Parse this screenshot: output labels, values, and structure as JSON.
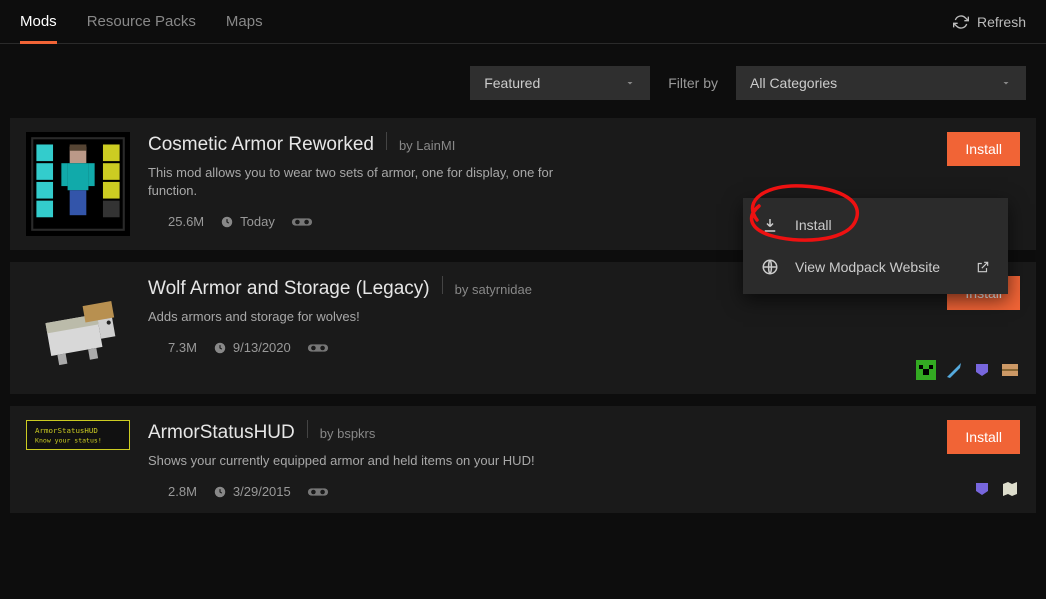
{
  "tabs": {
    "mods": "Mods",
    "resource_packs": "Resource Packs",
    "maps": "Maps",
    "refresh": "Refresh"
  },
  "filters": {
    "sort_selected": "Featured",
    "filter_label": "Filter by",
    "category_selected": "All Categories"
  },
  "context_menu": {
    "install": "Install",
    "view_site": "View Modpack Website"
  },
  "install_label": "Install",
  "mods": [
    {
      "title": "Cosmetic Armor Reworked",
      "author": "by LainMI",
      "desc": "This mod allows you to wear two sets of armor, one for display, one for function.",
      "downloads": "25.6M",
      "updated": "Today"
    },
    {
      "title": "Wolf Armor and Storage (Legacy)",
      "author": "by satyrnidae",
      "desc": "Adds armors and storage for wolves!",
      "downloads": "7.3M",
      "updated": "9/13/2020"
    },
    {
      "title": "ArmorStatusHUD",
      "author": "by bspkrs",
      "desc": "Shows your currently equipped armor and held items on your HUD!",
      "downloads": "2.8M",
      "updated": "3/29/2015"
    }
  ]
}
